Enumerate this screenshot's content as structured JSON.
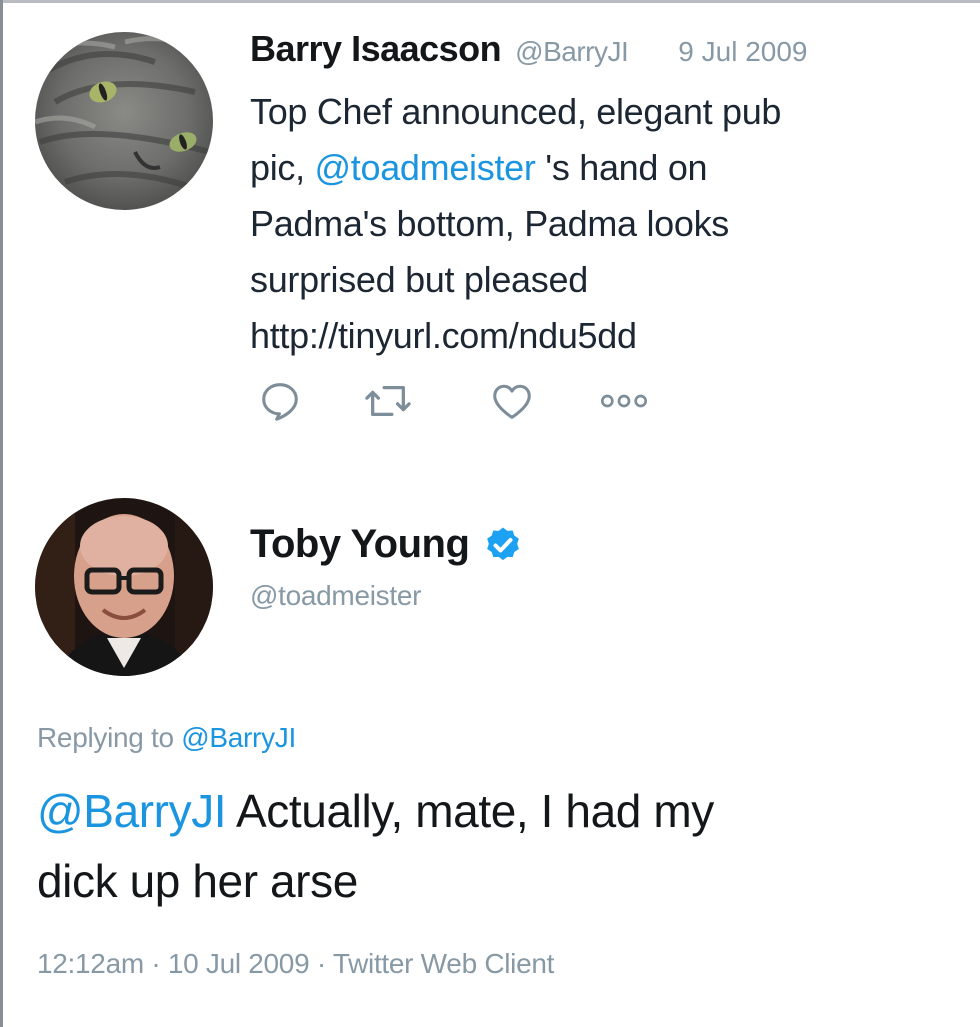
{
  "reply_tweet": {
    "author_name": "Barry Isaacson",
    "author_handle": "@BarryJI",
    "date": "9 Jul 2009",
    "text_lines": [
      {
        "before": "Top Chef announced, elegant pub",
        "mention": "",
        "after": ""
      },
      {
        "before": "pic, ",
        "mention": "@toadmeister",
        "after": " 's hand  on"
      },
      {
        "before": "Padma's bottom, Padma looks",
        "mention": "",
        "after": ""
      },
      {
        "before": "surprised but pleased",
        "mention": "",
        "after": ""
      },
      {
        "before": "http://tinyurl.com/ndu5dd",
        "mention": "",
        "after": ""
      }
    ],
    "actions": [
      {
        "name": "reply-icon"
      },
      {
        "name": "retweet-icon"
      },
      {
        "name": "like-icon"
      },
      {
        "name": "more-icon"
      }
    ]
  },
  "main_tweet": {
    "author_name": "Toby Young",
    "author_handle": "@toadmeister",
    "verified": true,
    "replying_prefix": "Replying to ",
    "replying_to": "@BarryJI",
    "text_lines": [
      {
        "mention": "@BarryJI",
        "text": " Actually, mate, I had my"
      },
      {
        "mention": "",
        "text": "dick up her arse"
      }
    ],
    "meta": {
      "time": "12:12am",
      "separator": " · ",
      "date": "10 Jul 2009",
      "source": "Twitter Web Client"
    }
  },
  "colors": {
    "link": "#1b95e0",
    "muted": "#8899a6",
    "text": "#14171a",
    "verified": "#1da1f2"
  }
}
